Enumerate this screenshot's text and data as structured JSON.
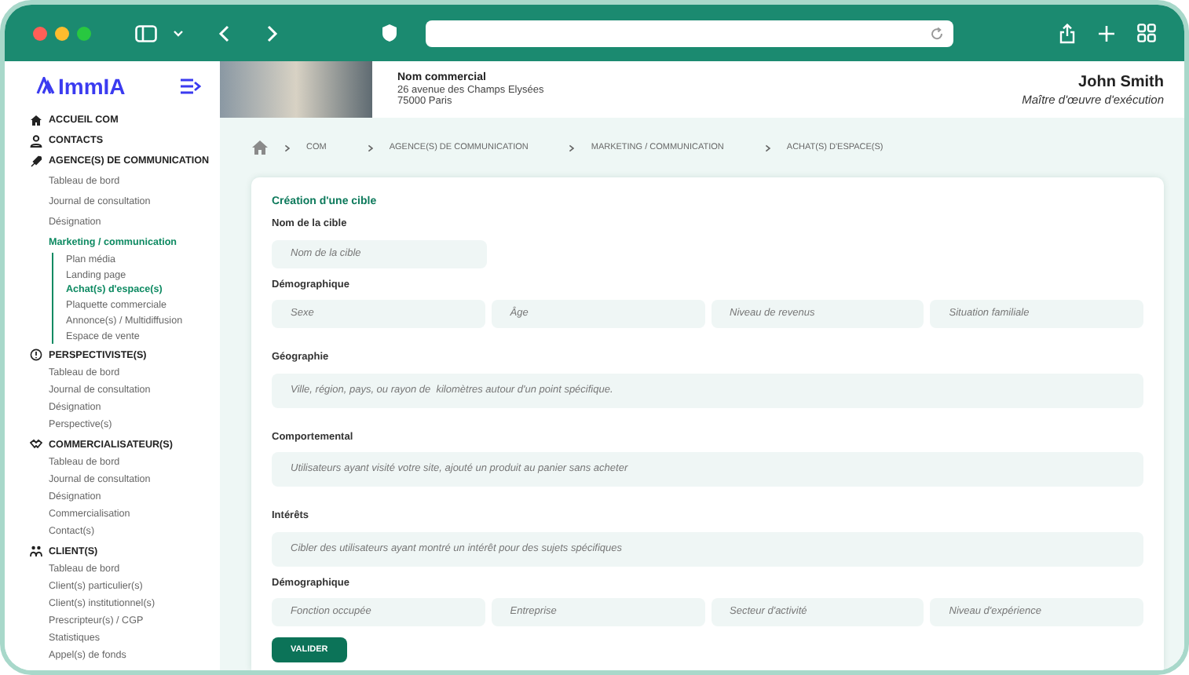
{
  "sidebar": {
    "logo": "ImmIA",
    "sections": [
      {
        "label": "ACCUEIL COM"
      },
      {
        "label": "CONTACTS"
      },
      {
        "label": "AGENCE(S) DE COMMUNICATION",
        "items": [
          {
            "label": "Tableau de bord",
            "selected": false
          },
          {
            "label": "Journal de consultation",
            "selected": false
          },
          {
            "label": "Désignation",
            "selected": false
          },
          {
            "label": "Marketing / communication",
            "selected": true,
            "children": [
              {
                "label": "Plan média",
                "selected": false
              },
              {
                "label": "Landing page",
                "selected": false
              },
              {
                "label": "Achat(s) d'espace(s)",
                "selected": true
              },
              {
                "label": "Plaquette commerciale",
                "selected": false
              },
              {
                "label": "Annonce(s) / Multidiffusion",
                "selected": false
              },
              {
                "label": "Espace de vente",
                "selected": false
              }
            ]
          }
        ]
      },
      {
        "label": "PERSPECTIVISTE(S)",
        "items": [
          {
            "label": "Tableau de bord",
            "selected": false
          },
          {
            "label": "Journal de consultation",
            "selected": false
          },
          {
            "label": "Désignation",
            "selected": false
          },
          {
            "label": "Perspective(s)",
            "selected": false
          }
        ]
      },
      {
        "label": "COMMERCIALISATEUR(S)",
        "items": [
          {
            "label": "Tableau de bord",
            "selected": false
          },
          {
            "label": "Journal de consultation",
            "selected": false
          },
          {
            "label": "Désignation",
            "selected": false
          },
          {
            "label": "Commercialisation",
            "selected": false
          },
          {
            "label": "Contact(s)",
            "selected": false
          }
        ]
      },
      {
        "label": "CLIENT(S)",
        "items": [
          {
            "label": "Tableau de bord",
            "selected": false
          },
          {
            "label": "Client(s) particulier(s)",
            "selected": false
          },
          {
            "label": "Client(s) institutionnel(s)",
            "selected": false
          },
          {
            "label": "Prescripteur(s) / CGP",
            "selected": false
          },
          {
            "label": "Statistiques",
            "selected": false
          },
          {
            "label": "Appel(s) de fonds",
            "selected": false
          }
        ]
      }
    ]
  },
  "header": {
    "company": "Nom commercial",
    "address_lines": [
      "26 avenue des Champs Elysées",
      "75000 Paris"
    ],
    "user_name": "John Smith",
    "user_role": "Maître d'œuvre d'exécution"
  },
  "breadcrumb": [
    "COM",
    "AGENCE(S) DE COMMUNICATION",
    "MARKETING / COMMUNICATION",
    "ACHAT(S) D'ESPACE(S)"
  ],
  "form": {
    "title": "Création d'une cible",
    "groups": [
      {
        "label": "Nom de la cible",
        "kind": "short",
        "fields": [
          {
            "placeholder": "Nom de la cible"
          }
        ]
      },
      {
        "label": "Démographique",
        "kind": "row",
        "fields": [
          {
            "placeholder": "Sexe"
          },
          {
            "placeholder": "Âge"
          },
          {
            "placeholder": "Niveau de revenus"
          },
          {
            "placeholder": "Situation familiale"
          }
        ]
      },
      {
        "label": "Géographie",
        "kind": "wide",
        "fields": [
          {
            "placeholder": "Ville, région, pays, ou rayon de  kilomètres autour d'un point spécifique."
          }
        ]
      },
      {
        "label": "Comportemental",
        "kind": "wide",
        "fields": [
          {
            "placeholder": "Utilisateurs ayant visité votre site, ajouté un produit au panier sans acheter"
          }
        ]
      },
      {
        "label": "Intérêts",
        "kind": "wide",
        "fields": [
          {
            "placeholder": "Cibler des utilisateurs ayant montré un intérêt pour des sujets spécifiques"
          }
        ]
      },
      {
        "label": "Démographique",
        "kind": "row",
        "fields": [
          {
            "placeholder": "Fonction occupée"
          },
          {
            "placeholder": "Entreprise"
          },
          {
            "placeholder": "Secteur d'activité"
          },
          {
            "placeholder": "Niveau d'expérience"
          }
        ]
      }
    ],
    "button": "VALIDER"
  }
}
